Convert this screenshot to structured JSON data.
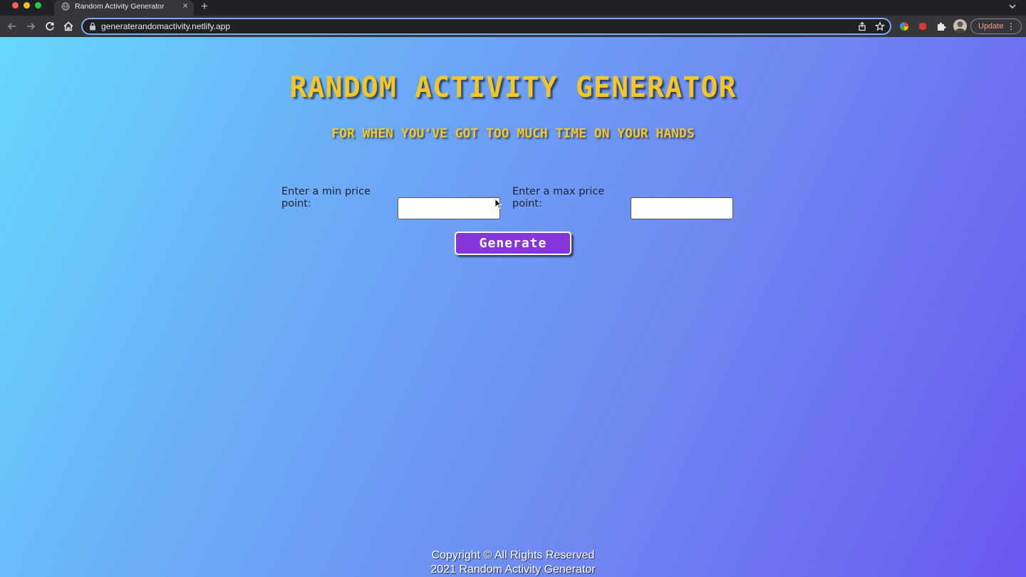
{
  "browser": {
    "tab_title": "Random Activity Generator",
    "tab_close": "×",
    "new_tab": "+",
    "url": "generaterandomactivity.netlify.app",
    "update_label": "Update",
    "menu_glyph": "⋮"
  },
  "icons": {
    "traffic": [
      "close-dot",
      "minimize-dot",
      "maximize-dot"
    ],
    "tab": "globe-icon",
    "nav": [
      "back-arrow-icon",
      "forward-arrow-icon",
      "reload-icon",
      "home-icon"
    ],
    "omnibox": [
      "lock-icon",
      "share-icon",
      "star-icon"
    ],
    "extensions": [
      "color-wheel-extension-icon",
      "red-extension-icon",
      "puzzle-icon"
    ]
  },
  "page": {
    "title": "RANDOM ACTIVITY GENERATOR",
    "subtitle": "FOR WHEN YOU'VE GOT TOO MUCH TIME ON YOUR HANDS",
    "min_label": "Enter a min price point:",
    "max_label": "Enter a max price point:",
    "min_value": "",
    "max_value": "",
    "generate_label": "Generate",
    "footer_line1": "Copyright © All Rights Reserved",
    "footer_line2": "2021 Random Activity Generator"
  },
  "colors": {
    "title_yellow": "#f0c62a",
    "button_purple": "#8836dc",
    "gradient_start": "#66d8fc",
    "gradient_end": "#6a58f0",
    "omnibox_focus": "#7caaf4",
    "update_text": "#f0a08a"
  }
}
